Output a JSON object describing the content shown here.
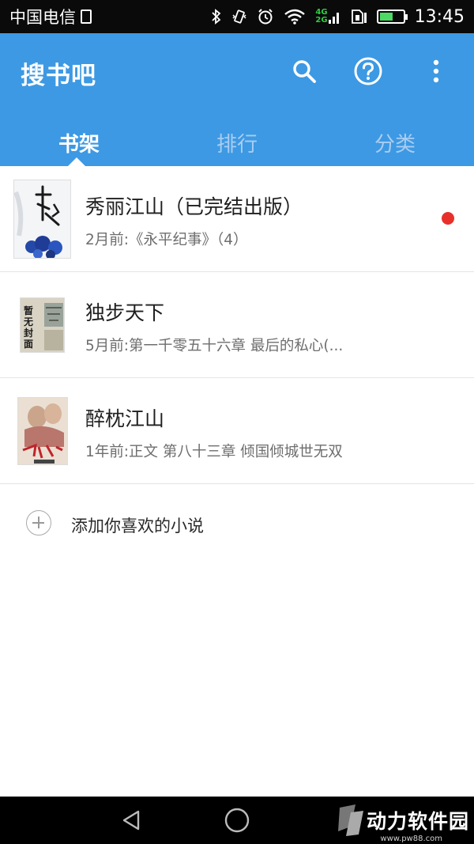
{
  "status_bar": {
    "carrier": "中国电信",
    "time": "13:45",
    "network_label_top": "4G",
    "network_label_bottom": "2G"
  },
  "app_bar": {
    "title": "搜书吧",
    "actions": [
      "search-icon",
      "help-icon",
      "more-vert-icon"
    ],
    "color": "#3d99e3"
  },
  "tabs": [
    {
      "label": "书架",
      "active": true
    },
    {
      "label": "排行",
      "active": false
    },
    {
      "label": "分类",
      "active": false
    }
  ],
  "books": [
    {
      "title": "秀丽江山（已完结出版）",
      "update": "2月前:《永平纪事》（4）",
      "has_new": true
    },
    {
      "title": "独步天下",
      "update": "5月前:第一千零五十六章 最后的私心(..."
    },
    {
      "title": "醉枕江山",
      "update": "1年前:正文 第八十三章 倾国倾城世无双"
    }
  ],
  "covers": {
    "placeholder_text": [
      "暂",
      "无",
      "封",
      "面"
    ]
  },
  "add_book": {
    "label": "添加你喜欢的小说"
  },
  "watermark": {
    "text": "动力软件园",
    "url": "www.pw88.com"
  },
  "accent_colors": {
    "new_dot": "#e8302b",
    "battery": "#4cd964"
  }
}
